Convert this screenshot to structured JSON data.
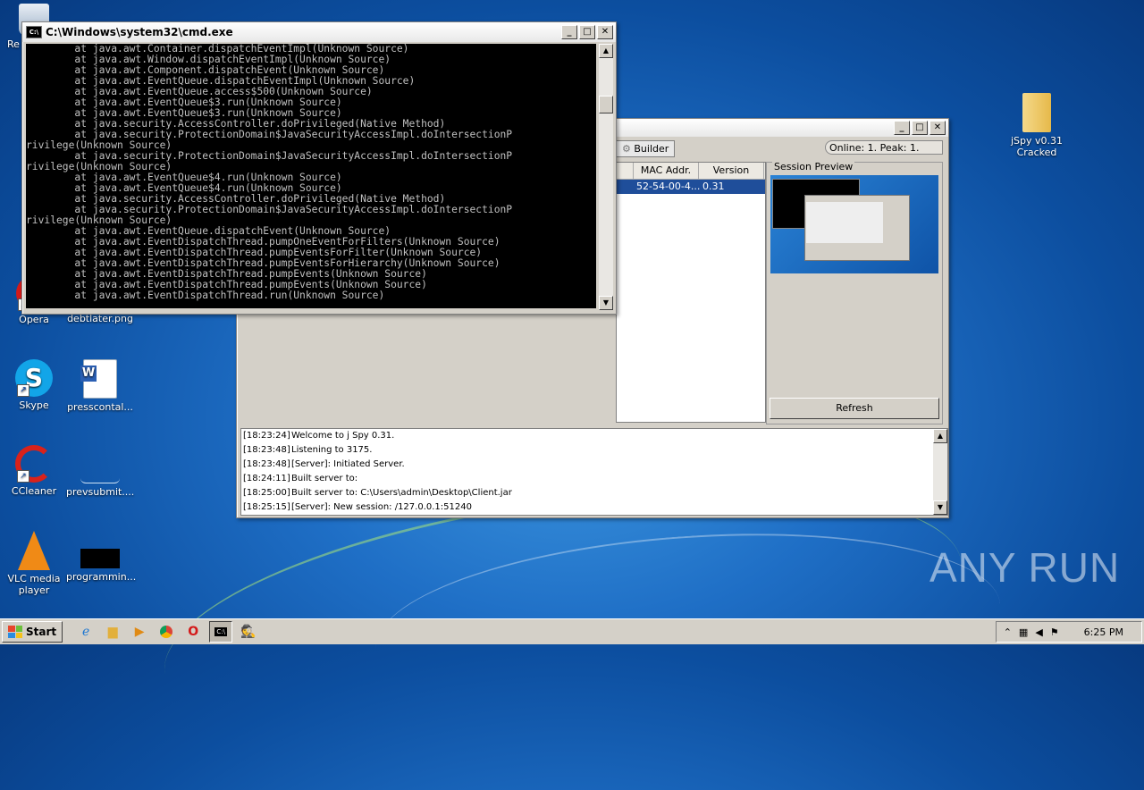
{
  "desktop": {
    "icons": [
      {
        "name": "recycle-bin",
        "label": "Re"
      },
      {
        "name": "opera",
        "label": "Opera"
      },
      {
        "name": "debtlater",
        "label": "debtlater.png"
      },
      {
        "name": "skype",
        "label": "Skype"
      },
      {
        "name": "presscontal",
        "label": "presscontal..."
      },
      {
        "name": "ccleaner",
        "label": "CCleaner"
      },
      {
        "name": "prevsubmit",
        "label": "prevsubmit...."
      },
      {
        "name": "vlc",
        "label": "VLC media player"
      },
      {
        "name": "programming",
        "label": "programmin..."
      },
      {
        "name": "jspy",
        "label": "jSpy v0.31 Cracked"
      }
    ],
    "watermark": "ANY RUN"
  },
  "cmd": {
    "title": "C:\\Windows\\system32\\cmd.exe",
    "lines": [
      "        at java.awt.Container.dispatchEventImpl(Unknown Source)",
      "        at java.awt.Window.dispatchEventImpl(Unknown Source)",
      "        at java.awt.Component.dispatchEvent(Unknown Source)",
      "        at java.awt.EventQueue.dispatchEventImpl(Unknown Source)",
      "        at java.awt.EventQueue.access$500(Unknown Source)",
      "        at java.awt.EventQueue$3.run(Unknown Source)",
      "        at java.awt.EventQueue$3.run(Unknown Source)",
      "        at java.security.AccessController.doPrivileged(Native Method)",
      "        at java.security.ProtectionDomain$JavaSecurityAccessImpl.doIntersectionP",
      "rivilege(Unknown Source)",
      "        at java.security.ProtectionDomain$JavaSecurityAccessImpl.doIntersectionP",
      "rivilege(Unknown Source)",
      "        at java.awt.EventQueue$4.run(Unknown Source)",
      "        at java.awt.EventQueue$4.run(Unknown Source)",
      "        at java.security.AccessController.doPrivileged(Native Method)",
      "        at java.security.ProtectionDomain$JavaSecurityAccessImpl.doIntersectionP",
      "rivilege(Unknown Source)",
      "        at java.awt.EventQueue.dispatchEvent(Unknown Source)",
      "        at java.awt.EventDispatchThread.pumpOneEventForFilters(Unknown Source)",
      "        at java.awt.EventDispatchThread.pumpEventsForFilter(Unknown Source)",
      "        at java.awt.EventDispatchThread.pumpEventsForHierarchy(Unknown Source)",
      "        at java.awt.EventDispatchThread.pumpEvents(Unknown Source)",
      "        at java.awt.EventDispatchThread.pumpEvents(Unknown Source)",
      "        at java.awt.EventDispatchThread.run(Unknown Source)"
    ]
  },
  "jspy": {
    "builder_tab": "Builder",
    "online_status": "Online: 1. Peak: 1.",
    "columns": [
      "MAC Addr.",
      "Version"
    ],
    "row": {
      "mac": "52-54-00-4...",
      "version": "0.31"
    },
    "session_preview_label": "Session Preview",
    "refresh_label": "Refresh",
    "log": [
      {
        "time": "[18:23:24]",
        "msg": "Welcome to j Spy 0.31."
      },
      {
        "time": "[18:23:48]",
        "msg": "Listening to 3175."
      },
      {
        "time": "[18:23:48]",
        "msg": "[Server]: Initiated Server."
      },
      {
        "time": "[18:24:11]",
        "msg": "Built server to:"
      },
      {
        "time": "[18:25:00]",
        "msg": "Built server to: C:\\Users\\admin\\Desktop\\Client.jar"
      },
      {
        "time": "[18:25:15]",
        "msg": "[Server]: New session: /127.0.0.1:51240"
      }
    ]
  },
  "taskbar": {
    "start_label": "Start",
    "clock": "6:25 PM"
  }
}
